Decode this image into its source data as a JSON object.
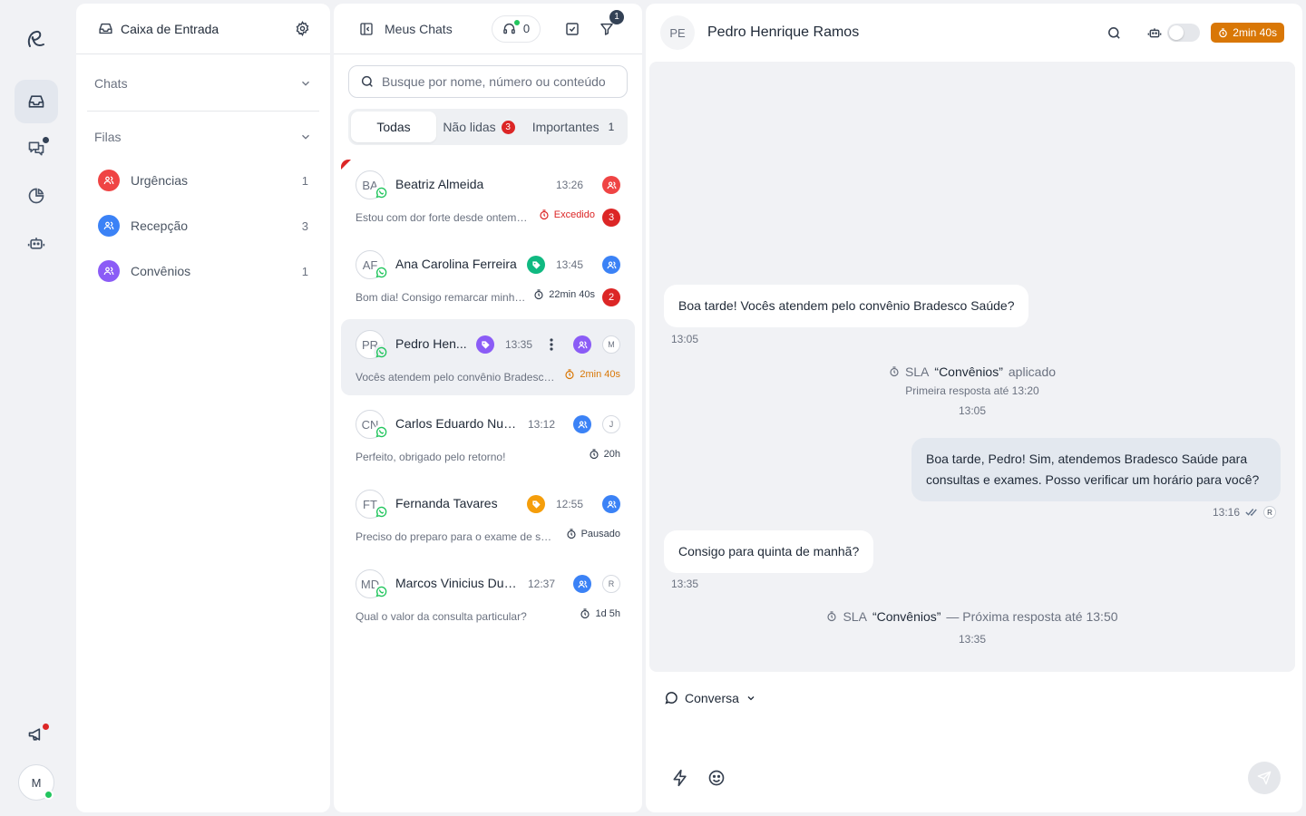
{
  "nav": {
    "logo": "e",
    "user_initial": "M",
    "items": [
      "inbox-icon",
      "chats-icon",
      "reports-icon",
      "bot-icon",
      "announcements-icon"
    ]
  },
  "inbox": {
    "title": "Caixa de Entrada",
    "sections": {
      "chats": "Chats",
      "queues": "Filas"
    },
    "queues": [
      {
        "label": "Urgências",
        "count": "1",
        "color": "#ef4444"
      },
      {
        "label": "Recepção",
        "count": "3",
        "color": "#3b82f6"
      },
      {
        "label": "Convênios",
        "count": "1",
        "color": "#8b5cf6"
      }
    ]
  },
  "chatlist": {
    "title": "Meus Chats",
    "agents_online": "0",
    "filter_count": "1",
    "search_placeholder": "Busque por nome, número ou conteúdo",
    "tabs": {
      "all": "Todas",
      "unread": "Não lidas",
      "unread_count": "3",
      "important": "Importantes",
      "important_count": "1"
    },
    "chats": [
      {
        "initials": "BA",
        "name": "Beatriz Almeida",
        "time": "13:26",
        "preview": "Estou com dor forte desde ontem, ...",
        "sla": "Excedido",
        "unread": "3",
        "queue_color": "#ef4444"
      },
      {
        "initials": "AF",
        "name": "Ana Carolina Ferreira",
        "time": "13:45",
        "preview": "Bom dia! Consigo remarcar minha ...",
        "sla": "22min 40s",
        "unread": "2",
        "queue_color": "#3b82f6",
        "tag_color": "#10b981"
      },
      {
        "initials": "PR",
        "name": "Pedro Hen...",
        "time": "13:35",
        "preview": "Vocês atendem pelo convênio Bradesco ...",
        "sla": "2min 40s",
        "user": "M",
        "queue_color": "#8b5cf6",
        "tag_color": "#8b5cf6"
      },
      {
        "initials": "CN",
        "name": "Carlos Eduardo Nunes",
        "time": "13:12",
        "preview": "Perfeito, obrigado pelo retorno!",
        "sla": "20h",
        "user": "J",
        "queue_color": "#3b82f6"
      },
      {
        "initials": "FT",
        "name": "Fernanda Tavares",
        "time": "12:55",
        "preview": "Preciso do preparo para o exame de sang...",
        "sla": "Pausado",
        "queue_color": "#3b82f6",
        "tag_color": "#f59e0b"
      },
      {
        "initials": "MD",
        "name": "Marcos Vinicius Dua...",
        "time": "12:37",
        "preview": "Qual o valor da consulta particular?",
        "sla": "1d 5h",
        "user": "R",
        "queue_color": "#3b82f6"
      }
    ]
  },
  "conversation": {
    "contact_initials": "PE",
    "contact_name": "Pedro Henrique Ramos",
    "sla_timer": "2min 40s",
    "messages": [
      {
        "text": "Boa tarde! Vocês atendem pelo convênio Bradesco Saúde?",
        "time": "13:05"
      },
      {
        "text_line1": "Boa tarde, Pedro! Sim, atendemos Bradesco Saúde para",
        "text_line2": "consultas e exames. Posso verificar um horário para você?",
        "time": "13:16",
        "agent": "R"
      },
      {
        "text": "Consigo para quinta de manhã?",
        "time": "13:35"
      }
    ],
    "system_events": [
      {
        "prefix": "SLA",
        "queue": "“Convênios”",
        "suffix": "aplicado",
        "detail": "Primeira resposta até 13:20",
        "time": "13:05"
      },
      {
        "prefix": "SLA",
        "queue": "“Convênios”",
        "suffix": "— Próxima resposta até 13:50",
        "time": "13:35"
      }
    ],
    "composer_mode": "Conversa"
  }
}
